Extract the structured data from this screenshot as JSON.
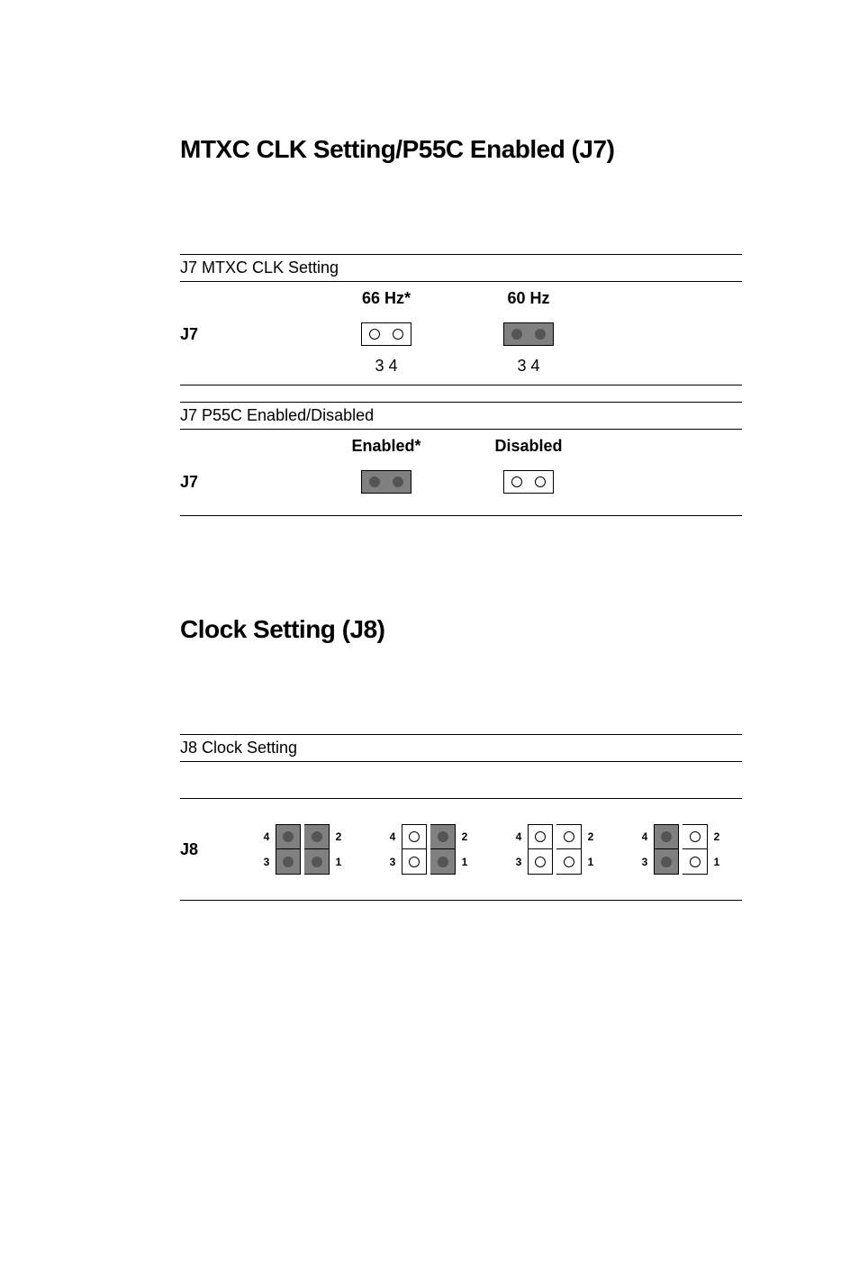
{
  "section1": {
    "title": "MTXC CLK Setting/P55C Enabled (J7)",
    "table1": {
      "header": "J7  MTXC CLK Setting",
      "rowlabel": "J7",
      "col1": {
        "label": "66 Hz*",
        "pins": "3   4",
        "state": "open"
      },
      "col2": {
        "label": "60 Hz",
        "pins": "3   4",
        "state": "closed"
      }
    },
    "table2": {
      "header": "J7  P55C Enabled/Disabled",
      "rowlabel": "J7",
      "col1": {
        "label": "Enabled*",
        "state": "closed"
      },
      "col2": {
        "label": "Disabled",
        "state": "open"
      }
    }
  },
  "section2": {
    "title": "Clock Setting (J8)",
    "table": {
      "header": "J8  Clock Setting",
      "rowlabel": "J8",
      "options": [
        {
          "shaded": [
            true,
            true,
            true,
            true
          ],
          "pin_labels": {
            "tl": "4",
            "tr": "2",
            "bl": "3",
            "br": "1"
          }
        },
        {
          "shaded": [
            false,
            true,
            false,
            true
          ],
          "pin_labels": {
            "tl": "4",
            "tr": "2",
            "bl": "3",
            "br": "1"
          }
        },
        {
          "shaded": [
            false,
            false,
            false,
            false
          ],
          "pin_labels": {
            "tl": "4",
            "tr": "2",
            "bl": "3",
            "br": "1"
          }
        },
        {
          "shaded": [
            true,
            false,
            true,
            false
          ],
          "pin_labels": {
            "tl": "4",
            "tr": "2",
            "bl": "3",
            "br": "1"
          }
        }
      ]
    }
  }
}
